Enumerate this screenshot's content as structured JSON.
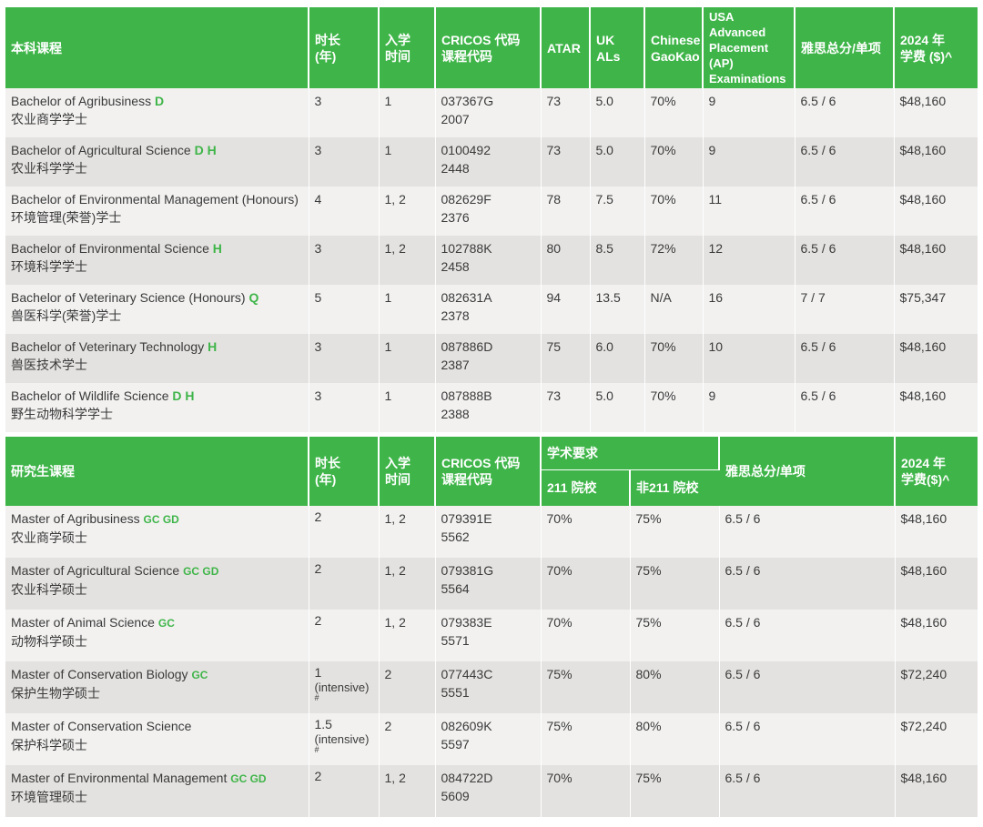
{
  "undergrad": {
    "headers": {
      "program": "本科课程",
      "duration": "时长\n(年)",
      "intake": "入学\n时间",
      "cricos": "CRICOS 代码\n课程代码",
      "atar": "ATAR",
      "ukal": "UK ALs",
      "gaokao": "Chinese\nGaoKao",
      "ap": "USA Advanced\nPlacement (AP)\nExaminations",
      "ielts": "雅思总分/单项",
      "fee": "2024 年\n学费 ($)^"
    },
    "rows": [
      {
        "name_en": "Bachelor of Agribusiness",
        "tag": "D",
        "name_zh": "农业商学学士",
        "duration": "3",
        "intake": "1",
        "cricos": "037367G",
        "code": "2007",
        "atar": "73",
        "ukal": "5.0",
        "gaokao": "70%",
        "ap": "9",
        "ielts": "6.5 / 6",
        "fee": "$48,160"
      },
      {
        "name_en": "Bachelor of Agricultural Science",
        "tag": "D H",
        "name_zh": "农业科学学士",
        "duration": "3",
        "intake": "1",
        "cricos": "0100492",
        "code": "2448",
        "atar": "73",
        "ukal": "5.0",
        "gaokao": "70%",
        "ap": "9",
        "ielts": "6.5 / 6",
        "fee": "$48,160"
      },
      {
        "name_en": "Bachelor of Environmental Management (Honours)",
        "tag": "",
        "name_zh": "环境管理(荣誉)学士",
        "duration": "4",
        "intake": "1, 2",
        "cricos": "082629F",
        "code": "2376",
        "atar": "78",
        "ukal": "7.5",
        "gaokao": "70%",
        "ap": "11",
        "ielts": "6.5 / 6",
        "fee": "$48,160"
      },
      {
        "name_en": "Bachelor of Environmental Science",
        "tag": "H",
        "name_zh": "环境科学学士",
        "duration": "3",
        "intake": "1, 2",
        "cricos": "102788K",
        "code": "2458",
        "atar": "80",
        "ukal": "8.5",
        "gaokao": "72%",
        "ap": "12",
        "ielts": "6.5 / 6",
        "fee": "$48,160"
      },
      {
        "name_en": "Bachelor of Veterinary Science (Honours)",
        "tag": "Q",
        "name_zh": "兽医科学(荣誉)学士",
        "duration": "5",
        "intake": "1",
        "cricos": "082631A",
        "code": "2378",
        "atar": "94",
        "ukal": "13.5",
        "gaokao": "N/A",
        "ap": "16",
        "ielts": "7 / 7",
        "fee": "$75,347"
      },
      {
        "name_en": "Bachelor of Veterinary Technology",
        "tag": "H",
        "name_zh": "兽医技术学士",
        "duration": "3",
        "intake": "1",
        "cricos": "087886D",
        "code": "2387",
        "atar": "75",
        "ukal": "6.0",
        "gaokao": "70%",
        "ap": "10",
        "ielts": "6.5 / 6",
        "fee": "$48,160"
      },
      {
        "name_en": "Bachelor of Wildlife Science",
        "tag": "D H",
        "name_zh": "野生动物科学学士",
        "duration": "3",
        "intake": "1",
        "cricos": "087888B",
        "code": "2388",
        "atar": "73",
        "ukal": "5.0",
        "gaokao": "70%",
        "ap": "9",
        "ielts": "6.5 / 6",
        "fee": "$48,160"
      }
    ]
  },
  "postgrad": {
    "headers": {
      "program": "研究生课程",
      "duration": "时长\n(年)",
      "intake": "入学\n时间",
      "cricos": "CRICOS 代码\n课程代码",
      "academic": "学术要求",
      "c211": "211 院校",
      "non211": "非211 院校",
      "ielts": "雅思总分/单项",
      "fee": "2024 年\n学费($)^"
    },
    "rows": [
      {
        "name_en": "Master of Agribusiness",
        "tag": "GC GD",
        "name_zh": "农业商学硕士",
        "duration": "2",
        "duration_note": "",
        "duration_mark": "",
        "intake": "1, 2",
        "cricos": "079391E",
        "code": "5562",
        "c211": "70%",
        "non211": "75%",
        "ielts": "6.5 / 6",
        "fee": "$48,160"
      },
      {
        "name_en": "Master of Agricultural Science",
        "tag": "GC GD",
        "name_zh": "农业科学硕士",
        "duration": "2",
        "duration_note": "",
        "duration_mark": "",
        "intake": "1, 2",
        "cricos": "079381G",
        "code": "5564",
        "c211": "70%",
        "non211": "75%",
        "ielts": "6.5 / 6",
        "fee": "$48,160"
      },
      {
        "name_en": "Master of Animal Science",
        "tag": "GC",
        "name_zh": "动物科学硕士",
        "duration": "2",
        "duration_note": "",
        "duration_mark": "",
        "intake": "1, 2",
        "cricos": "079383E",
        "code": "5571",
        "c211": "70%",
        "non211": "75%",
        "ielts": "6.5 / 6",
        "fee": "$48,160"
      },
      {
        "name_en": "Master of Conservation Biology",
        "tag": "GC",
        "name_zh": "保护生物学硕士",
        "duration": "1",
        "duration_note": "(intensive)",
        "duration_mark": "#",
        "intake": "2",
        "cricos": "077443C",
        "code": "5551",
        "c211": "75%",
        "non211": "80%",
        "ielts": "6.5 / 6",
        "fee": "$72,240"
      },
      {
        "name_en": "Master of Conservation Science",
        "tag": "",
        "name_zh": "保护科学硕士",
        "duration": "1.5",
        "duration_note": "(intensive)",
        "duration_mark": "#",
        "intake": "2",
        "cricos": "082609K",
        "code": "5597",
        "c211": "75%",
        "non211": "80%",
        "ielts": "6.5 / 6",
        "fee": "$72,240"
      },
      {
        "name_en": "Master of Environmental Management",
        "tag": "GC GD",
        "name_zh": "环境管理硕士",
        "duration": "2",
        "duration_note": "",
        "duration_mark": "",
        "intake": "1, 2",
        "cricos": "084722D",
        "code": "5609",
        "c211": "70%",
        "non211": "75%",
        "ielts": "6.5 / 6",
        "fee": "$48,160"
      }
    ]
  },
  "colors": {
    "header_green": "#3fb549",
    "tag_green": "#3fb549",
    "row_light": "#f2f1f0",
    "row_dark": "#e4e2e0",
    "text": "#3a3a3a"
  }
}
